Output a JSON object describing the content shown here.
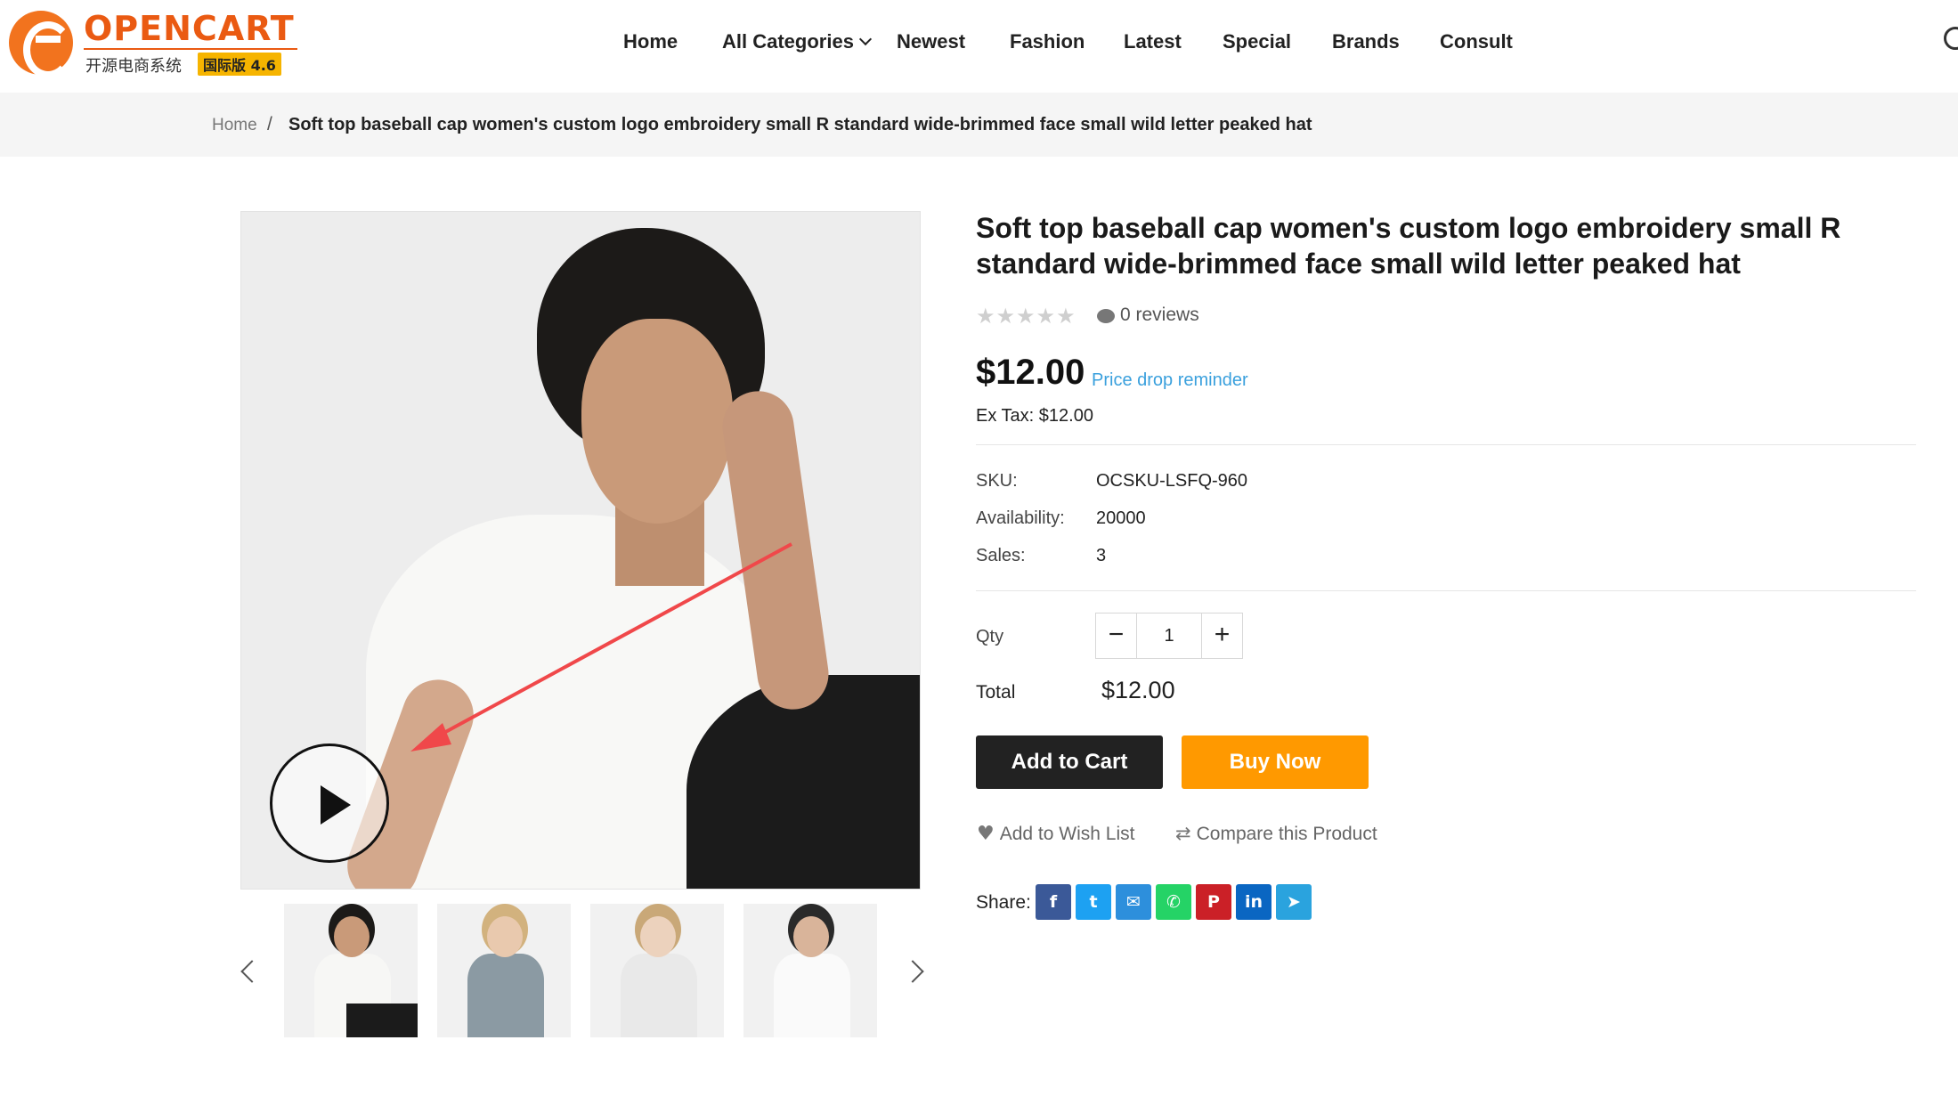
{
  "logo": {
    "name": "OPENCART",
    "subtitle": "开源电商系统",
    "version": "国际版 4.6"
  },
  "nav": {
    "items": [
      "Home",
      "All Categories",
      "Newest",
      "Fashion",
      "Latest",
      "Special",
      "Brands",
      "Consult"
    ]
  },
  "breadcrumb": {
    "home": "Home",
    "separator": "/",
    "current": "Soft top baseball cap women's custom logo embroidery small R standard wide-brimmed face small wild letter peaked hat"
  },
  "product": {
    "title": "Soft top baseball cap women's custom logo embroidery small R standard wide-brimmed face small wild letter peaked hat",
    "rating": 0,
    "reviews": "0 reviews",
    "price": "$12.00",
    "price_drop": "Price drop reminder",
    "ex_tax": "Ex Tax: $12.00",
    "sku_label": "SKU:",
    "sku": "OCSKU-LSFQ-960",
    "availability_label": "Availability:",
    "availability": "20000",
    "sales_label": "Sales:",
    "sales": "3",
    "qty_label": "Qty",
    "qty": "1",
    "total_label": "Total",
    "total": "$12.00"
  },
  "actions": {
    "add_to_cart": "Add to Cart",
    "buy_now": "Buy Now",
    "wish_list": "Add to Wish List",
    "compare": "Compare this Product",
    "share_label": "Share:"
  },
  "share": [
    {
      "name": "facebook",
      "glyph": "f",
      "color": "#3b5998"
    },
    {
      "name": "twitter",
      "glyph": "t",
      "color": "#1da1f2"
    },
    {
      "name": "email",
      "glyph": "✉",
      "color": "#2d8fdc"
    },
    {
      "name": "whatsapp",
      "glyph": "✆",
      "color": "#25d366"
    },
    {
      "name": "pinterest",
      "glyph": "P",
      "color": "#cb2027"
    },
    {
      "name": "linkedin",
      "glyph": "in",
      "color": "#0a66c2"
    },
    {
      "name": "telegram",
      "glyph": "➤",
      "color": "#2aa3de"
    }
  ],
  "thumbnails": [
    {
      "name": "white-tank-top",
      "top_color": "#f7f7f5",
      "skin": "#c99a79",
      "hair": "#1c1a18",
      "legs": true
    },
    {
      "name": "grey-crop-top",
      "top_color": "#8b9aa3",
      "skin": "#e9c9ae",
      "hair": "#d2b27e",
      "legs": false
    },
    {
      "name": "white-floral-shirt",
      "top_color": "#e9e9e9",
      "skin": "#ecd2bd",
      "hair": "#c9a878",
      "legs": false
    },
    {
      "name": "white-tshirt",
      "top_color": "#fafafa",
      "skin": "#d9b49a",
      "hair": "#2a2a2a",
      "legs": false
    }
  ],
  "colors": {
    "brand": "#ea5a12",
    "buy_now": "#ff9900",
    "add_to_cart": "#222222",
    "link": "#3aa0dd"
  }
}
